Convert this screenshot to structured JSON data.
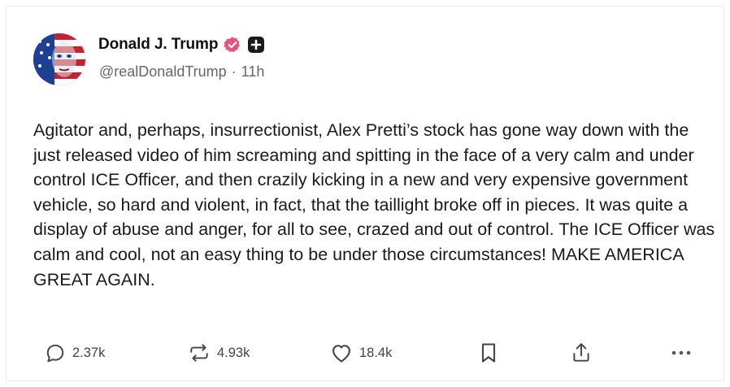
{
  "post": {
    "author": {
      "display_name": "Donald J. Trump",
      "handle": "@realDonaldTrump",
      "separator": "·",
      "time_ago": "11h",
      "verified": true,
      "verified_color": "#e8547a"
    },
    "body": "Agitator and, perhaps, insurrectionist, Alex Pretti’s stock has gone way down with the just released video of him screaming and spitting in the face of a very calm and under control ICE Officer, and then crazily kicking in a new and very expensive government vehicle, so hard and violent, in fact, that the taillight broke off in pieces. It was quite a display of abuse and anger, for all to see, crazed and out of control. The ICE Officer was calm and cool, not an easy thing to be under those circumstances! MAKE AMERICA GREAT AGAIN.",
    "actions": {
      "replies": {
        "icon": "reply-icon",
        "count": "2.37k"
      },
      "retruths": {
        "icon": "retruth-icon",
        "count": "4.93k"
      },
      "likes": {
        "icon": "heart-icon",
        "count": "18.4k"
      },
      "bookmark": {
        "icon": "bookmark-icon"
      },
      "share": {
        "icon": "share-icon"
      },
      "more": {
        "icon": "more-icon"
      }
    }
  }
}
